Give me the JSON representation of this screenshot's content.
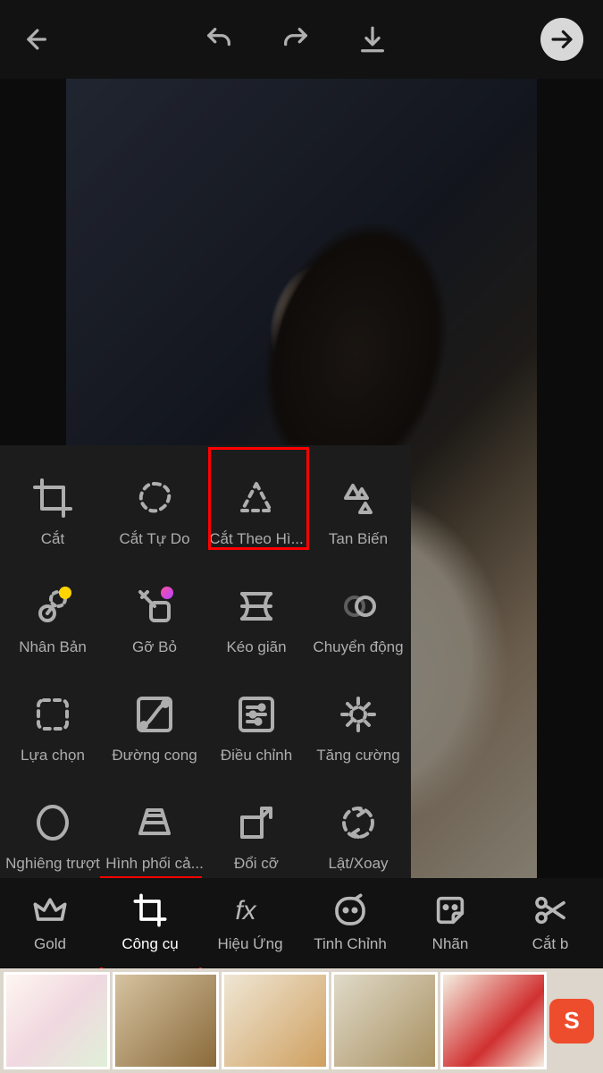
{
  "topbar": {
    "back": "back",
    "undo": "undo",
    "redo": "redo",
    "download": "download",
    "next": "next"
  },
  "tools": [
    {
      "id": "crop",
      "label": "Cắt"
    },
    {
      "id": "free-crop",
      "label": "Cắt Tự Do"
    },
    {
      "id": "shape-crop",
      "label": "Cắt Theo Hì..."
    },
    {
      "id": "dispersion",
      "label": "Tan Biến"
    },
    {
      "id": "clone",
      "label": "Nhân Bản"
    },
    {
      "id": "remove",
      "label": "Gỡ Bỏ"
    },
    {
      "id": "stretch",
      "label": "Kéo giãn"
    },
    {
      "id": "motion",
      "label": "Chuyển động"
    },
    {
      "id": "selection",
      "label": "Lựa chọn"
    },
    {
      "id": "curves",
      "label": "Đường cong"
    },
    {
      "id": "adjust",
      "label": "Điều chỉnh"
    },
    {
      "id": "enhance",
      "label": "Tăng cường"
    },
    {
      "id": "tilt-shift",
      "label": "Nghiêng trượt"
    },
    {
      "id": "perspective",
      "label": "Hình phối cả..."
    },
    {
      "id": "resize",
      "label": "Đổi cỡ"
    },
    {
      "id": "flip-rotate",
      "label": "Lật/Xoay"
    }
  ],
  "nav": [
    {
      "id": "gold",
      "label": "Gold"
    },
    {
      "id": "tools",
      "label": "Công cụ"
    },
    {
      "id": "fx",
      "label": "Hiệu Ứng"
    },
    {
      "id": "finetune",
      "label": "Tinh Chỉnh"
    },
    {
      "id": "sticker",
      "label": "Nhãn"
    },
    {
      "id": "cutout",
      "label": "Cắt b"
    }
  ],
  "highlights": {
    "tool_index": 2,
    "nav_index": 1
  },
  "ad_badge": "S"
}
